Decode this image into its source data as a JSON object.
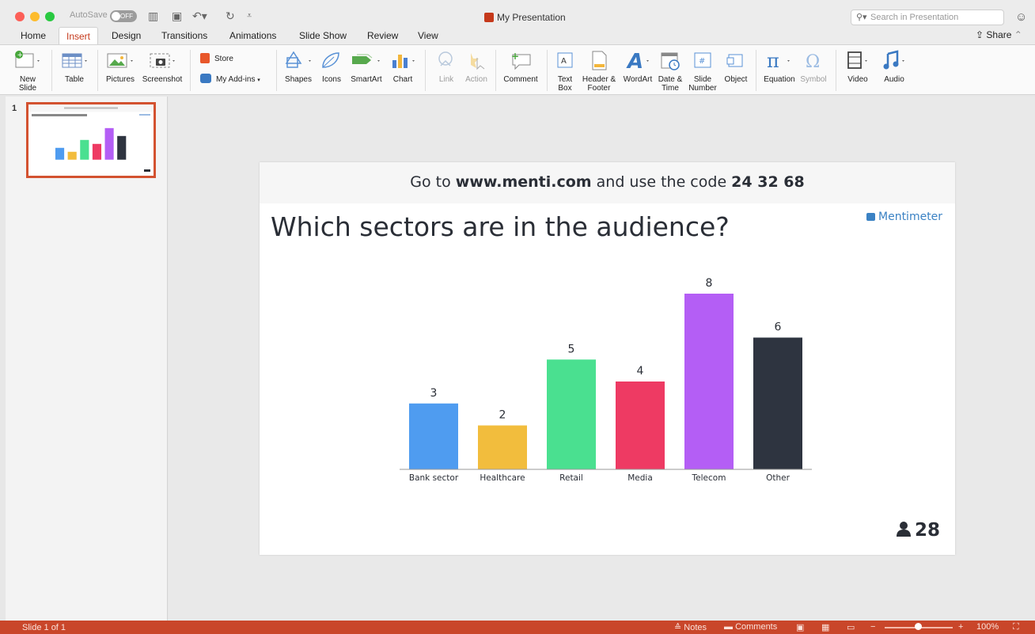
{
  "window": {
    "autosave_label": "AutoSave",
    "autosave_state": "OFF",
    "title": "My Presentation",
    "search_placeholder": "Search in Presentation"
  },
  "tabs": [
    "Home",
    "Insert",
    "Design",
    "Transitions",
    "Animations",
    "Slide Show",
    "Review",
    "View"
  ],
  "active_tab": "Insert",
  "share_label": "Share",
  "ribbon": {
    "new_slide": [
      "New",
      "Slide"
    ],
    "table": "Table",
    "pictures": "Pictures",
    "screenshot": "Screenshot",
    "store": "Store",
    "my_addins": "My Add-ins",
    "shapes": "Shapes",
    "icons": "Icons",
    "smartart": "SmartArt",
    "chart": "Chart",
    "link": "Link",
    "action": "Action",
    "comment": "Comment",
    "text_box": [
      "Text",
      "Box"
    ],
    "header_footer": [
      "Header &",
      "Footer"
    ],
    "wordart": "WordArt",
    "date_time": [
      "Date &",
      "Time"
    ],
    "slide_number": [
      "Slide",
      "Number"
    ],
    "object": "Object",
    "equation": "Equation",
    "symbol": "Symbol",
    "video": "Video",
    "audio": "Audio"
  },
  "thumbnails": {
    "slide_number": "1"
  },
  "slide": {
    "instruction_prefix": "Go to ",
    "instruction_url": "www.menti.com",
    "instruction_mid": " and use the code ",
    "instruction_code": "24 32 68",
    "question": "Which sectors are in the audience?",
    "brand": "Mentimeter",
    "participant_count": "28"
  },
  "chart_data": {
    "type": "bar",
    "categories": [
      "Bank sector",
      "Healthcare",
      "Retail",
      "Media",
      "Telecom",
      "Other"
    ],
    "values": [
      3,
      2,
      5,
      4,
      8,
      6
    ],
    "colors": [
      "#4f9cf0",
      "#f2bd3d",
      "#4ae090",
      "#ee3a63",
      "#b45ef5",
      "#2e3440"
    ],
    "title": "",
    "xlabel": "",
    "ylabel": "",
    "ylim": [
      0,
      8
    ],
    "grid": false,
    "data_labels": true
  },
  "status_bar": {
    "slide_indicator": "Slide 1 of 1",
    "notes": "Notes",
    "comments": "Comments",
    "zoom": "100%"
  }
}
